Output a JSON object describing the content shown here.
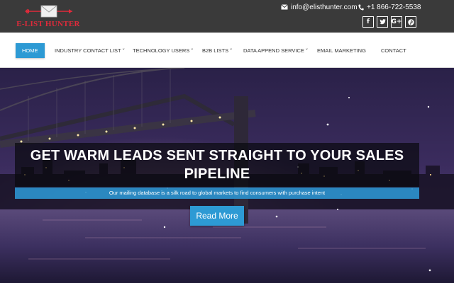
{
  "brand": {
    "logo_text": "E-LIST HUNTER"
  },
  "contact": {
    "email": "info@elisthunter.com",
    "email_icon": "envelope-icon",
    "phone": "+1 866-722-5538",
    "phone_icon": "phone-icon"
  },
  "social": [
    {
      "icon": "facebook-icon",
      "glyph": "f"
    },
    {
      "icon": "twitter-icon",
      "glyph": "t"
    },
    {
      "icon": "google-plus-icon",
      "glyph": "G+"
    },
    {
      "icon": "pinterest-icon",
      "glyph": "P"
    }
  ],
  "nav": {
    "items": [
      {
        "label": "HOME",
        "active": true
      },
      {
        "label": "INDUSTRY CONTACT LIST",
        "dropdown": true
      },
      {
        "label": "TECHNOLOGY USERS",
        "dropdown": true
      },
      {
        "label": "B2B LISTS",
        "dropdown": true
      },
      {
        "label": "DATA APPEND SERVICE",
        "dropdown": true
      },
      {
        "label": "EMAIL MARKETING"
      },
      {
        "label": "CONTACT"
      }
    ]
  },
  "hero": {
    "headline_line1": "GET WARM LEADS SENT STRAIGHT TO YOUR SALES",
    "headline_line2": "PIPELINE",
    "subline": "Our mailing database is a silk road to global markets to find consumers with purchase intent",
    "cta_label": "Read More"
  },
  "colors": {
    "accent": "#2d9ad4",
    "topbar": "#3a3a3a",
    "logo_red": "#e02a3a"
  }
}
